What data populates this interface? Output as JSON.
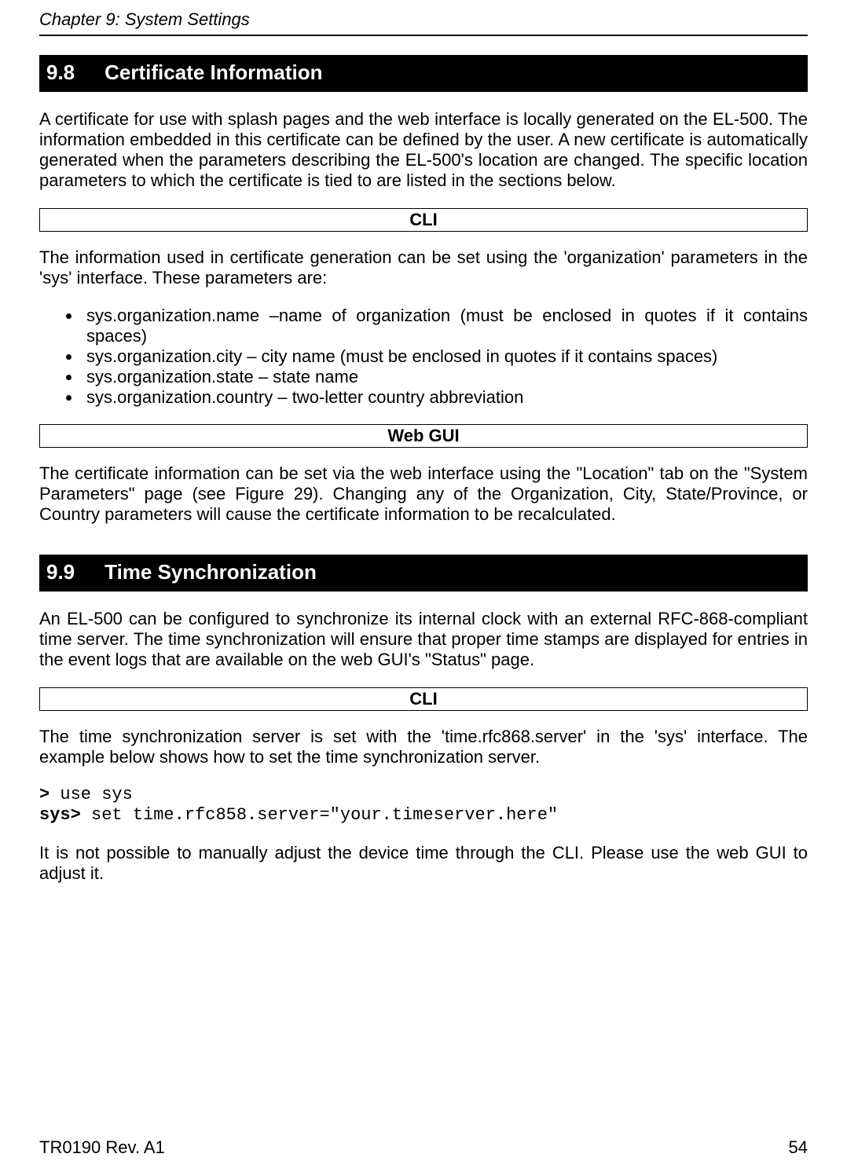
{
  "header": {
    "chapter": "Chapter 9: System Settings"
  },
  "section_98": {
    "number": "9.8",
    "title": "Certificate Information",
    "intro": "A certificate for use with splash pages and the web interface is locally generated on the EL-500. The information embedded in this certificate can be defined by the user. A new certificate is automatically generated when the parameters describing the EL-500's location are changed. The specific location parameters to which the certificate is tied to are listed in the sections below.",
    "cli_label": "CLI",
    "cli_intro": "The information used in certificate generation can be set using the 'organization' parameters in the 'sys' interface. These parameters are:",
    "params": [
      "sys.organization.name –name of organization (must be enclosed in quotes if it contains spaces)",
      "sys.organization.city – city name (must be enclosed in quotes if it contains spaces)",
      "sys.organization.state – state name",
      "sys.organization.country – two-letter country abbreviation"
    ],
    "webgui_label": "Web GUI",
    "webgui_text": "The certificate information can be set via the web interface using the \"Location\" tab on the \"System Parameters\" page (see Figure 29). Changing any of the Organization, City, State/Province, or Country parameters will cause the certificate information to be recalculated."
  },
  "section_99": {
    "number": "9.9",
    "title": "Time Synchronization",
    "intro": "An EL-500 can be configured to synchronize its internal clock with an external RFC-868-compliant time server. The time synchronization will ensure that proper time stamps are displayed for entries in the event logs that are available on the web GUI's \"Status\" page.",
    "cli_label": "CLI",
    "cli_intro": "The time synchronization server is set with the 'time.rfc868.server' in the 'sys' interface. The example below shows how to set the time synchronization server.",
    "code": {
      "prompt1": ">",
      "cmd1": " use sys",
      "prompt2": "sys>",
      "cmd2": " set time.rfc858.server=\"your.timeserver.here\""
    },
    "cli_note": "It is not possible to manually adjust the device time through the CLI. Please use the web GUI to adjust it."
  },
  "footer": {
    "doc_rev": "TR0190 Rev. A1",
    "page": "54"
  }
}
